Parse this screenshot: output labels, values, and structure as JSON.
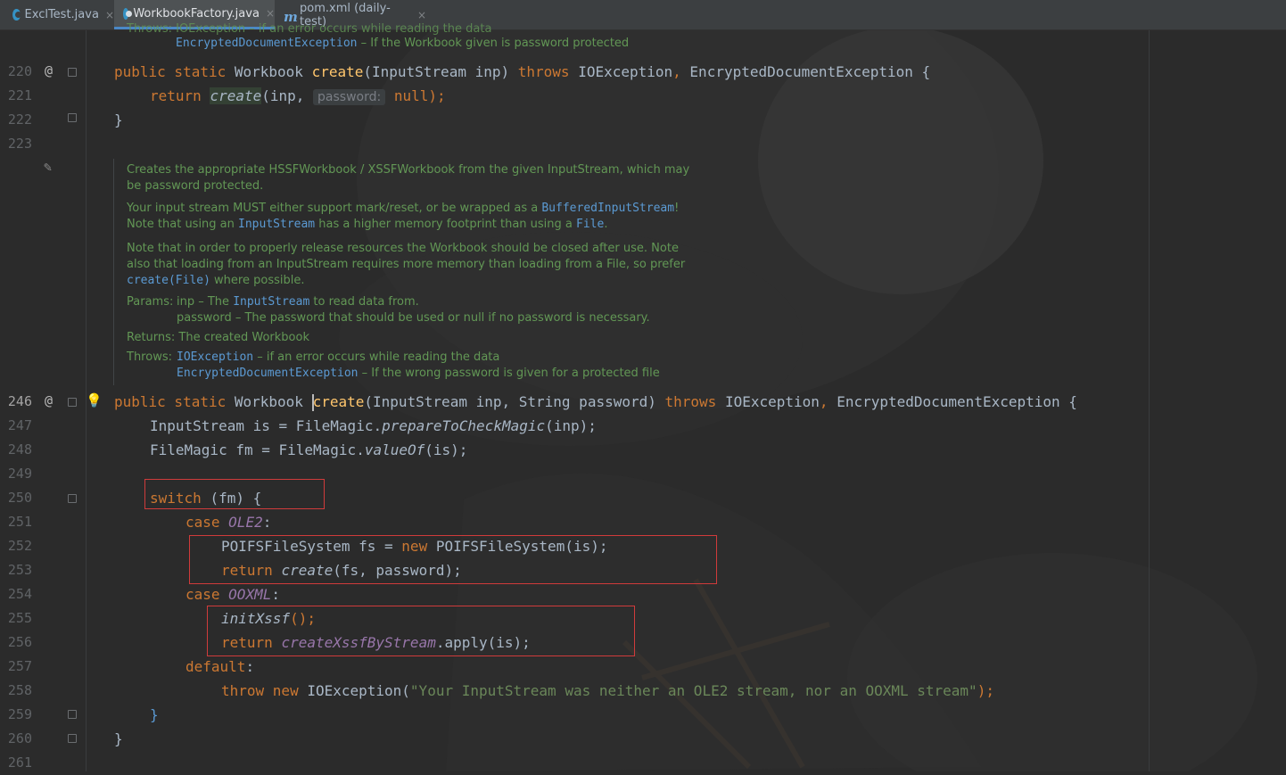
{
  "tabs": [
    {
      "label": "ExclTest.java",
      "icon": "java-class-icon",
      "active": false
    },
    {
      "label": "WorkbookFactory.java",
      "icon": "java-class-file-icon",
      "active": true
    },
    {
      "label": "pom.xml (daily-test)",
      "icon": "maven-icon",
      "active": false
    }
  ],
  "close_glyph": "×",
  "gutter": {
    "line_numbers": [
      "220",
      "221",
      "222",
      "223",
      "246",
      "247",
      "248",
      "249",
      "250",
      "251",
      "252",
      "253",
      "254",
      "255",
      "256",
      "257",
      "258",
      "259",
      "260",
      "261"
    ],
    "override_marker": "@",
    "bulb_icon": "lightbulb-icon",
    "edit_icon": "pencil-icon"
  },
  "doc_top": {
    "throws_partial": "Throws:  IOException – if an error occurs while reading the data",
    "encrypted_code": "EncryptedDocumentException",
    "encrypted_text": " – If the Workbook given is password protected"
  },
  "javadoc": {
    "p1_l1": "Creates the appropriate HSSFWorkbook / XSSFWorkbook from the given InputStream, which may",
    "p1_l2": "be password protected.",
    "p2_l1_pre": "Your input stream MUST either support mark/reset, or be wrapped as a ",
    "p2_l1_code": "BufferedInputStream",
    "p2_l1_post": "!",
    "p2_l2_pre": "Note that using an ",
    "p2_l2_code": "InputStream",
    "p2_l2_mid": " has a higher memory footprint than using a ",
    "p2_l2_code2": "File",
    "p2_l2_post": ".",
    "p3_l1": "Note that in order to properly release resources the Workbook should be closed after use. Note",
    "p3_l2": "also that loading from an InputStream requires more memory than loading from a File, so prefer",
    "p3_l3_code": "create(File)",
    "p3_l3_post": " where possible.",
    "params_label": "Params:",
    "param1_pre": "inp – The ",
    "param1_code": "InputStream",
    "param1_post": " to read data from.",
    "param2": "password – The password that should be used or null if no password is necessary.",
    "returns": "Returns: The created Workbook",
    "throws_label": "Throws:",
    "throws1_code": "IOException",
    "throws1_post": " – if an error occurs while reading the data",
    "throws2_code": "EncryptedDocumentException",
    "throws2_post": " – If the wrong password is given for a protected file"
  },
  "code": {
    "l220": {
      "kw1": "public static ",
      "type": "Workbook ",
      "fn": "create",
      "args": "(InputStream inp) ",
      "kw2": "throws ",
      "ex1": "IOException",
      ",": ", ",
      "ex2": "EncryptedDocumentException ",
      "brace": "{"
    },
    "l221": {
      "kw": "return ",
      "fn": "create",
      "open": "(inp, ",
      "hint": "password:",
      "val": " null",
      "close": ");"
    },
    "l222": {
      "brace": "}"
    },
    "l246": {
      "kw1": "public static ",
      "type": "Workbook ",
      "fn": "create",
      "args": "(InputStream inp, String password) ",
      "kw2": "throws ",
      "ex1": "IOException",
      ",": ", ",
      "ex2": "EncryptedDocumentException ",
      "brace": "{"
    },
    "l247": {
      "pre": "InputStream is = FileMagic.",
      "fn": "prepareToCheckMagic",
      "post": "(inp);"
    },
    "l248": {
      "pre": "FileMagic fm = FileMagic.",
      "fn": "valueOf",
      "post": "(is);"
    },
    "l250": {
      "kw": "switch ",
      "post": "(fm) {"
    },
    "l251": {
      "kw": "case ",
      "cn": "OLE2",
      ":": ":"
    },
    "l252": {
      "pre": "POIFSFileSystem fs = ",
      "kw": "new ",
      "post": "POIFSFileSystem(is);"
    },
    "l253": {
      "kw": "return ",
      "fn": "create",
      "post": "(fs, password);"
    },
    "l254": {
      "kw": "case ",
      "cn": "OOXML",
      ":": ":"
    },
    "l255": {
      "fn": "initXssf",
      "post": "();"
    },
    "l256": {
      "kw": "return ",
      "cn": "createXssfByStream",
      "post": ".apply(is);"
    },
    "l257": {
      "kw": "default",
      ":": ":"
    },
    "l258": {
      "kw": "throw new ",
      "pre": "IOException(",
      "str": "\"Your InputStream was neither an OLE2 stream, nor an OOXML stream\"",
      "post": ");"
    },
    "l259": {
      "brace": "}"
    },
    "l260": {
      "brace": "}"
    }
  },
  "colors": {
    "keyword": "#cc7832",
    "function": "#ffc66d",
    "constant": "#9876aa",
    "string": "#6a8759",
    "doc": "#629755",
    "highlight": "#d03b3b"
  }
}
